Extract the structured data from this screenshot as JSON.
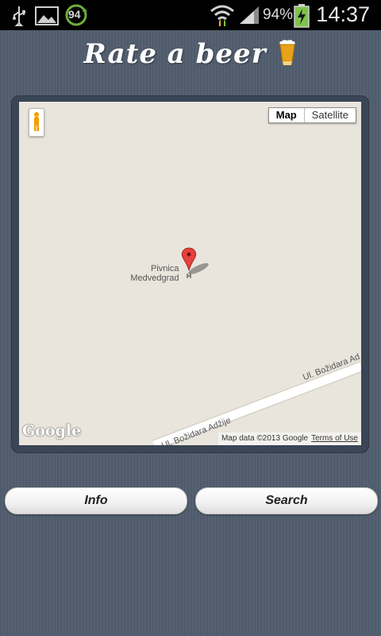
{
  "status_bar": {
    "notification_badge": "94",
    "battery_percent": "94%",
    "time": "14:37",
    "icons": [
      "usb-icon",
      "image-icon",
      "sync-badge-icon",
      "wifi-icon",
      "signal-icon",
      "battery-charging-icon"
    ]
  },
  "app": {
    "title": "Rate a beer",
    "title_icon": "beer-glass-icon"
  },
  "map": {
    "type_options": [
      "Map",
      "Satellite"
    ],
    "selected_type": "Map",
    "place_label_line1": "Pivnica",
    "place_label_line2": "Medvedgrad",
    "road_label_1": "Ul. Božidara Ad",
    "road_label_2": "Ul. Božidara Adžije",
    "logo": "Google",
    "attribution": "Map data ©2013 Google",
    "terms_link": "Terms of Use",
    "colors": {
      "background": "#e9e5dc",
      "road": "#ffffff",
      "marker": "#e8413d"
    }
  },
  "buttons": {
    "info_label": "Info",
    "search_label": "Search"
  }
}
